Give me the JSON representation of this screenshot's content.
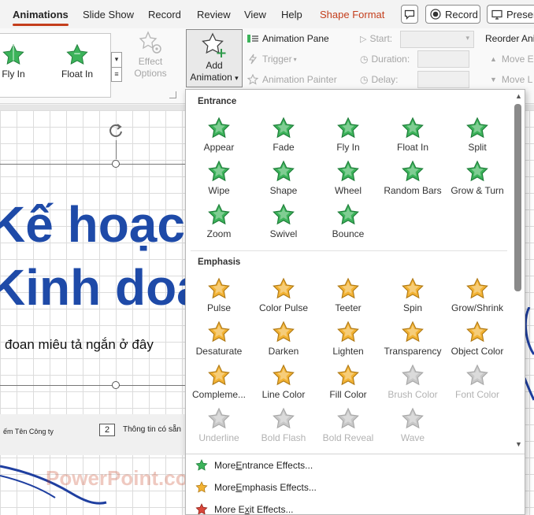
{
  "tabs": [
    {
      "label": "Animations",
      "active": true
    },
    {
      "label": "Slide Show"
    },
    {
      "label": "Record"
    },
    {
      "label": "Review"
    },
    {
      "label": "View"
    },
    {
      "label": "Help"
    },
    {
      "label": "Shape Format"
    }
  ],
  "top_buttons": {
    "record_label": "Record",
    "present_label": "Presen"
  },
  "ribbon": {
    "gallery": [
      {
        "label": "Fly In"
      },
      {
        "label": "Float In"
      }
    ],
    "effect_options": [
      "Effect",
      "Options"
    ],
    "add_animation": [
      "Add",
      "Animation"
    ],
    "animation_pane": "Animation Pane",
    "trigger": "Trigger",
    "animation_painter": "Animation Painter",
    "start_label": "Start:",
    "duration_label": "Duration:",
    "delay_label": "Delay:",
    "reorder_label": "Reorder Ani",
    "move_earlier": "Move E",
    "move_later": "Move L"
  },
  "slide": {
    "title_line1": "Kế hoạch",
    "title_line2": "Kinh doa",
    "subtitle": "đoan miêu tả ngắn ở đây",
    "footer_company": "ếm Tên Công ty",
    "footer_number": "2",
    "footer_info": "Thông tin có sẵn",
    "watermark": "PowerPoint.com.vn"
  },
  "dropdown": {
    "entrance_title": "Entrance",
    "entrance": [
      {
        "label": "Appear",
        "enabled": true
      },
      {
        "label": "Fade",
        "enabled": true
      },
      {
        "label": "Fly In",
        "enabled": true
      },
      {
        "label": "Float In",
        "enabled": true
      },
      {
        "label": "Split",
        "enabled": true
      },
      {
        "label": "Wipe",
        "enabled": true
      },
      {
        "label": "Shape",
        "enabled": true
      },
      {
        "label": "Wheel",
        "enabled": true
      },
      {
        "label": "Random Bars",
        "enabled": true
      },
      {
        "label": "Grow & Turn",
        "enabled": true
      },
      {
        "label": "Zoom",
        "enabled": true
      },
      {
        "label": "Swivel",
        "enabled": true
      },
      {
        "label": "Bounce",
        "enabled": true
      }
    ],
    "emphasis_title": "Emphasis",
    "emphasis": [
      {
        "label": "Pulse",
        "enabled": true
      },
      {
        "label": "Color Pulse",
        "enabled": true
      },
      {
        "label": "Teeter",
        "enabled": true
      },
      {
        "label": "Spin",
        "enabled": true
      },
      {
        "label": "Grow/Shrink",
        "enabled": true
      },
      {
        "label": "Desaturate",
        "enabled": true
      },
      {
        "label": "Darken",
        "enabled": true
      },
      {
        "label": "Lighten",
        "enabled": true
      },
      {
        "label": "Transparency",
        "enabled": true
      },
      {
        "label": "Object Color",
        "enabled": true
      },
      {
        "label": "Compleme...",
        "enabled": true
      },
      {
        "label": "Line Color",
        "enabled": true
      },
      {
        "label": "Fill Color",
        "enabled": true
      },
      {
        "label": "Brush Color",
        "enabled": false
      },
      {
        "label": "Font Color",
        "enabled": false
      },
      {
        "label": "Underline",
        "enabled": false
      },
      {
        "label": "Bold Flash",
        "enabled": false
      },
      {
        "label": "Bold Reveal",
        "enabled": false
      },
      {
        "label": "Wave",
        "enabled": false
      }
    ],
    "more_entrance": {
      "pre": "More ",
      "key": "E",
      "post": "ntrance Effects..."
    },
    "more_emphasis": {
      "pre": "More ",
      "key": "E",
      "post": "mphasis Effects..."
    },
    "more_exit": {
      "pre": "More E",
      "key": "x",
      "post": "it Effects..."
    }
  },
  "colors": {
    "accent": "#c43e1c",
    "entrance_green": "#3cb35a",
    "emphasis_gold": "#f2b233",
    "exit_red": "#d9473b",
    "disabled_gray": "#c8c8c8",
    "title_blue": "#1e4aa8"
  }
}
